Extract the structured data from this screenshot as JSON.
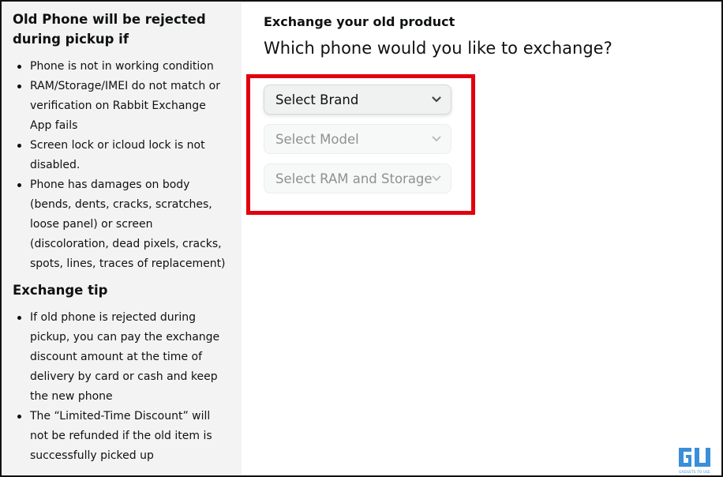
{
  "left_panel": {
    "rejected_title": "Old Phone will be rejected during pickup if",
    "rejected_items": [
      "Phone is not in working condition",
      "RAM/Storage/IMEI do not match or verification on Rabbit Exchange App fails",
      "Screen lock or icloud lock is not disabled.",
      "Phone has damages on body (bends, dents, cracks, scratches, loose panel) or screen (discoloration, dead pixels, cracks, spots, lines, traces of replacement)"
    ],
    "tip_title": "Exchange tip",
    "tip_items": [
      "If old phone is rejected during pickup, you can pay the exchange discount amount at the time of delivery by card or cash and keep the new phone",
      "The “Limited-Time Discount” will not be refunded if the old item is successfully picked up"
    ]
  },
  "exchange": {
    "subheading": "Exchange your old product",
    "question": "Which phone would you like to exchange?",
    "brand_select": "Select Brand",
    "model_select": "Select Model",
    "ram_select": "Select RAM and Storage"
  },
  "watermark": {
    "icon": "gadgets-to-use-logo",
    "text": "GADGETS TO USE",
    "color": "#3a8fd8"
  },
  "colors": {
    "highlight_border": "#e0000f",
    "left_panel_bg": "#f3f3f3",
    "text": "#0f1111",
    "disabled_text": "#8f9191"
  }
}
